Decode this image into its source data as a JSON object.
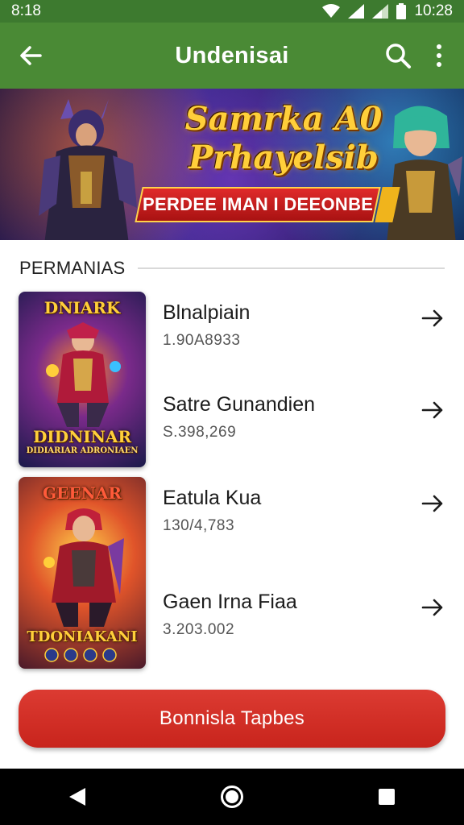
{
  "status_bar": {
    "time": "8:18",
    "clock": "10:28",
    "icons": [
      "wifi-icon",
      "signal-icon",
      "signal-icon",
      "battery-icon"
    ]
  },
  "app_bar": {
    "title": "Undenisai",
    "back_icon": "back-arrow-icon",
    "search_icon": "search-icon",
    "menu_icon": "more-vert-icon"
  },
  "banner": {
    "title_line1": "Samrka A0",
    "title_line2": "Prhayelsib",
    "ribbon_text": "PERDEE IMAN I DEEONBE"
  },
  "section": {
    "title": "PERMANIAS"
  },
  "cards": [
    {
      "art_top": "DNIARK",
      "art_bottom": "DIDNINAR",
      "art_caption": "DIDIARIAR ADRONIAEN"
    },
    {
      "art_top": "GEENAR",
      "art_bottom": "TDONIAKANI"
    }
  ],
  "items": [
    {
      "title": "Blnalpiain",
      "subtitle": "1.90A8933"
    },
    {
      "title": "Satre Gunandien",
      "subtitle": "S.398,269"
    },
    {
      "title": "Eatula Kua",
      "subtitle": "130/4,783"
    },
    {
      "title": "Gaen Irna Fiaa",
      "subtitle": "3.203.002"
    }
  ],
  "cta": {
    "label": "Bonnisla Tapbes"
  },
  "nav": {
    "back": "nav-back-icon",
    "home": "nav-home-icon",
    "recents": "nav-recents-icon"
  },
  "colors": {
    "app_bar": "#4a8a35",
    "status_bar": "#3d7a2f",
    "cta": "#d8322a"
  }
}
